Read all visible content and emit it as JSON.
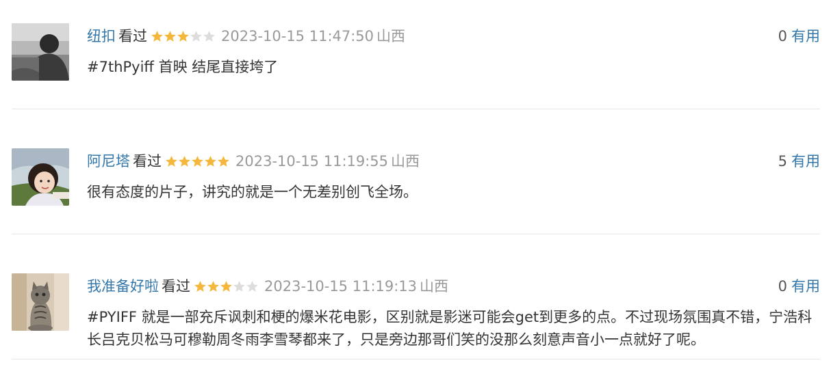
{
  "comments": [
    {
      "user": "纽扣",
      "status": "看过",
      "rating": 3,
      "time": "2023-10-15 11:47:50",
      "location": "山西",
      "votes": "0",
      "vote_label": "有用",
      "text": "#7thPyiff 首映 结尾直接垮了",
      "avatar_icon": "user-avatar-photo"
    },
    {
      "user": "阿尼塔",
      "status": "看过",
      "rating": 5,
      "time": "2023-10-15 11:19:55",
      "location": "山西",
      "votes": "5",
      "vote_label": "有用",
      "text": "很有态度的片子，讲究的就是一个无差别创飞全场。",
      "avatar_icon": "user-avatar-photo"
    },
    {
      "user": "我准备好啦",
      "status": "看过",
      "rating": 3,
      "time": "2023-10-15 11:19:13",
      "location": "山西",
      "votes": "0",
      "vote_label": "有用",
      "text": "#PYIFF 就是一部充斥讽刺和梗的爆米花电影，区别就是影迷可能会get到更多的点。不过现场氛围真不错，宁浩科长吕克贝松马可穆勒周冬雨李雪琴都来了，只是旁边那哥们笑的没那么刻意声音小一点就好了呢。",
      "avatar_icon": "cat-avatar-photo"
    }
  ],
  "colors": {
    "link": "#3377aa",
    "star_on": "#f4b73b",
    "star_off": "#dddddd",
    "meta": "#999999"
  }
}
